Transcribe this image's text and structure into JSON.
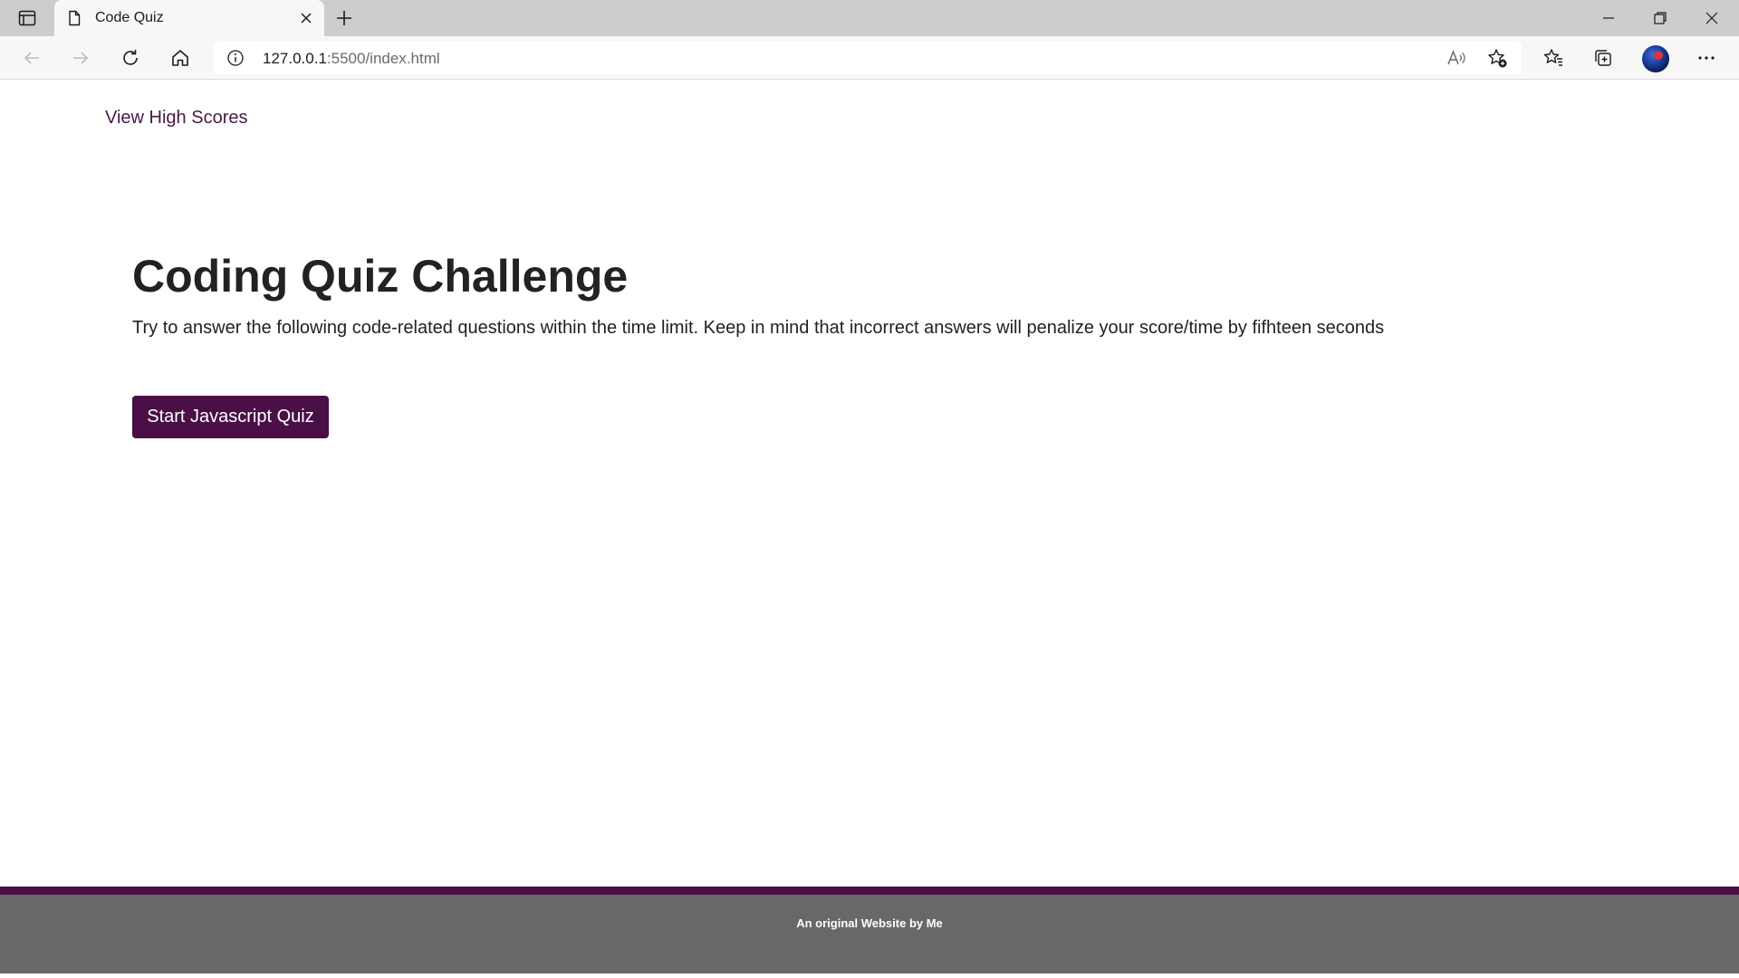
{
  "browser": {
    "tab_title": "Code Quiz",
    "url_host": "127.0.0.1",
    "url_rest": ":5500/index.html"
  },
  "page": {
    "high_scores_link": "View High Scores",
    "title": "Coding Quiz Challenge",
    "intro": "Try to answer the following code-related questions within the time limit. Keep in mind that incorrect answers will penalize your score/time by fifhteen seconds",
    "start_button": "Start Javascript Quiz",
    "footer": "An original Website by Me"
  },
  "colors": {
    "accent": "#4a0f47",
    "link": "#4a1945",
    "footer_bg": "#686868",
    "text": "#222222"
  }
}
